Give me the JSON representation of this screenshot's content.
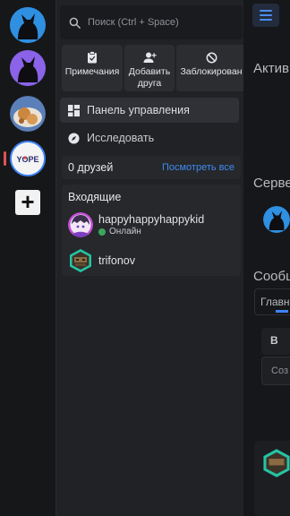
{
  "servers": [
    {
      "icon": "cat-silhouette-server-icon",
      "bg": "#2f8fe0"
    },
    {
      "icon": "cat-silhouette-purple-server-icon",
      "bg": "#8a63e8"
    },
    {
      "icon": "food-photo-server-icon",
      "bg": "#c98a4b"
    },
    {
      "icon": "yope-server-icon",
      "label": "YOPE",
      "bg": "#f1f1f1"
    }
  ],
  "rail": {
    "add_label": "+"
  },
  "search": {
    "placeholder": "Поиск (Ctrl + Space)"
  },
  "actions": [
    {
      "icon": "clipboard-icon",
      "label": "Примечания"
    },
    {
      "icon": "add-friend-icon",
      "label": "Добавить друга"
    },
    {
      "icon": "blocked-icon",
      "label": "Заблокирован"
    }
  ],
  "nav": {
    "dashboard": "Панель управления",
    "explore": "Исследовать"
  },
  "friends": {
    "count_label": "0 друзей",
    "see_all": "Посмотреть все"
  },
  "incoming": {
    "title": "Входящие",
    "requests": [
      {
        "name": "happyhappyhappykid",
        "status": "Онлайн",
        "status_color": "#3ba55d"
      },
      {
        "name": "trifonov",
        "status": ""
      }
    ]
  },
  "background": {
    "heading_1": "Актив",
    "heading_2": "Серве",
    "heading_3": "Сообщ",
    "tab": "Главн",
    "button": "В",
    "input": "Соз"
  },
  "colors": {
    "accent": "#3e82f7",
    "online": "#3ba55d",
    "link": "#3e8bf0"
  }
}
